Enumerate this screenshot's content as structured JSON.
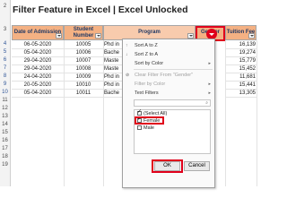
{
  "title": "Filter Feature in Excel | Excel Unlocked",
  "row_numbers": [
    "2",
    "3",
    "4",
    "5",
    "6",
    "7",
    "8",
    "9",
    "10",
    "11",
    "12",
    "13",
    "14",
    "15",
    "16",
    "17",
    "18",
    "19"
  ],
  "headers": {
    "date": "Date of Admission",
    "student_line1": "Student",
    "student_line2": "Number",
    "program": "Program",
    "gender": "Gender",
    "fee": "Tuition Fee"
  },
  "rows": [
    {
      "date": "06-05-2020",
      "num": "10005",
      "prog": "Phd in",
      "fee": "16,139"
    },
    {
      "date": "05-04-2020",
      "num": "10006",
      "prog": "Bache",
      "fee": "19,274"
    },
    {
      "date": "29-04-2020",
      "num": "10007",
      "prog": "Maste",
      "fee": "15,779"
    },
    {
      "date": "29-04-2020",
      "num": "10008",
      "prog": "Maste",
      "fee": "15,452"
    },
    {
      "date": "24-04-2020",
      "num": "10009",
      "prog": "Phd in",
      "fee": "11,681"
    },
    {
      "date": "20-05-2020",
      "num": "10010",
      "prog": "Phd in",
      "fee": "15,441"
    },
    {
      "date": "05-04-2020",
      "num": "10011",
      "prog": "Bache",
      "fee": "13,305"
    }
  ],
  "menu": {
    "sort_az": "Sort A to Z",
    "sort_za": "Sort Z to A",
    "sort_color": "Sort by Color",
    "clear_filter": "Clear Filter From \"Gender\"",
    "filter_color": "Filter by Color",
    "text_filters": "Text Filters",
    "select_all": "(Select All)",
    "female": "Female",
    "male": "Male",
    "ok": "OK",
    "cancel": "Cancel"
  }
}
